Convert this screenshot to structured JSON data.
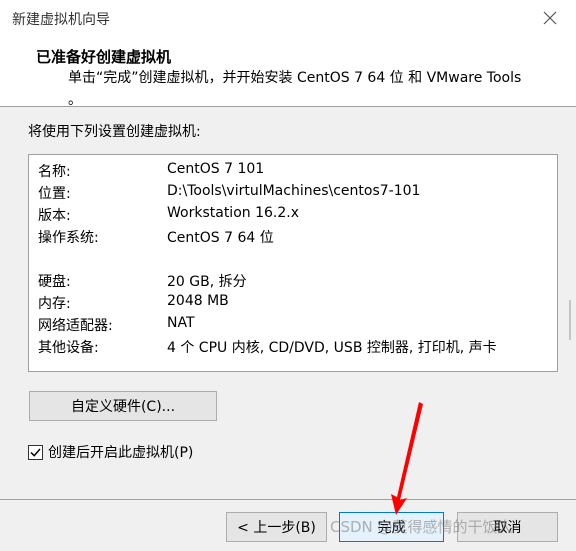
{
  "window": {
    "title": "新建虚拟机向导"
  },
  "header": {
    "title": "已准备好创建虚拟机",
    "description": "单击“完成”创建虚拟机，并开始安装 CentOS 7 64 位 和 VMware Tools",
    "description_tail": "。"
  },
  "intro": "将使用下列设置创建虚拟机:",
  "summary": [
    {
      "label": "名称:",
      "value": "CentOS 7 101"
    },
    {
      "label": "位置:",
      "value": "D:\\Tools\\virtulMachines\\centos7-101"
    },
    {
      "label": "版本:",
      "value": "Workstation 16.2.x"
    },
    {
      "label": "操作系统:",
      "value": "CentOS 7 64 位"
    },
    {
      "label": "硬盘:",
      "value": "20 GB, 拆分"
    },
    {
      "label": "内存:",
      "value": "2048 MB"
    },
    {
      "label": "网络适配器:",
      "value": "NAT"
    },
    {
      "label": "其他设备:",
      "value": "4 个 CPU 内核, CD/DVD, USB 控制器, 打印机, 声卡"
    }
  ],
  "customize_button": "自定义硬件(C)...",
  "power_on_checkbox": {
    "label": "创建后开启此虚拟机(P)",
    "checked": true
  },
  "buttons": {
    "back": "< 上一步(B)",
    "finish": "完成",
    "cancel": "取消"
  },
  "watermark": "CSDN @莫得感情的干饭人",
  "colors": {
    "arrow": "#ff0000",
    "finish_border": "#0078d7"
  }
}
